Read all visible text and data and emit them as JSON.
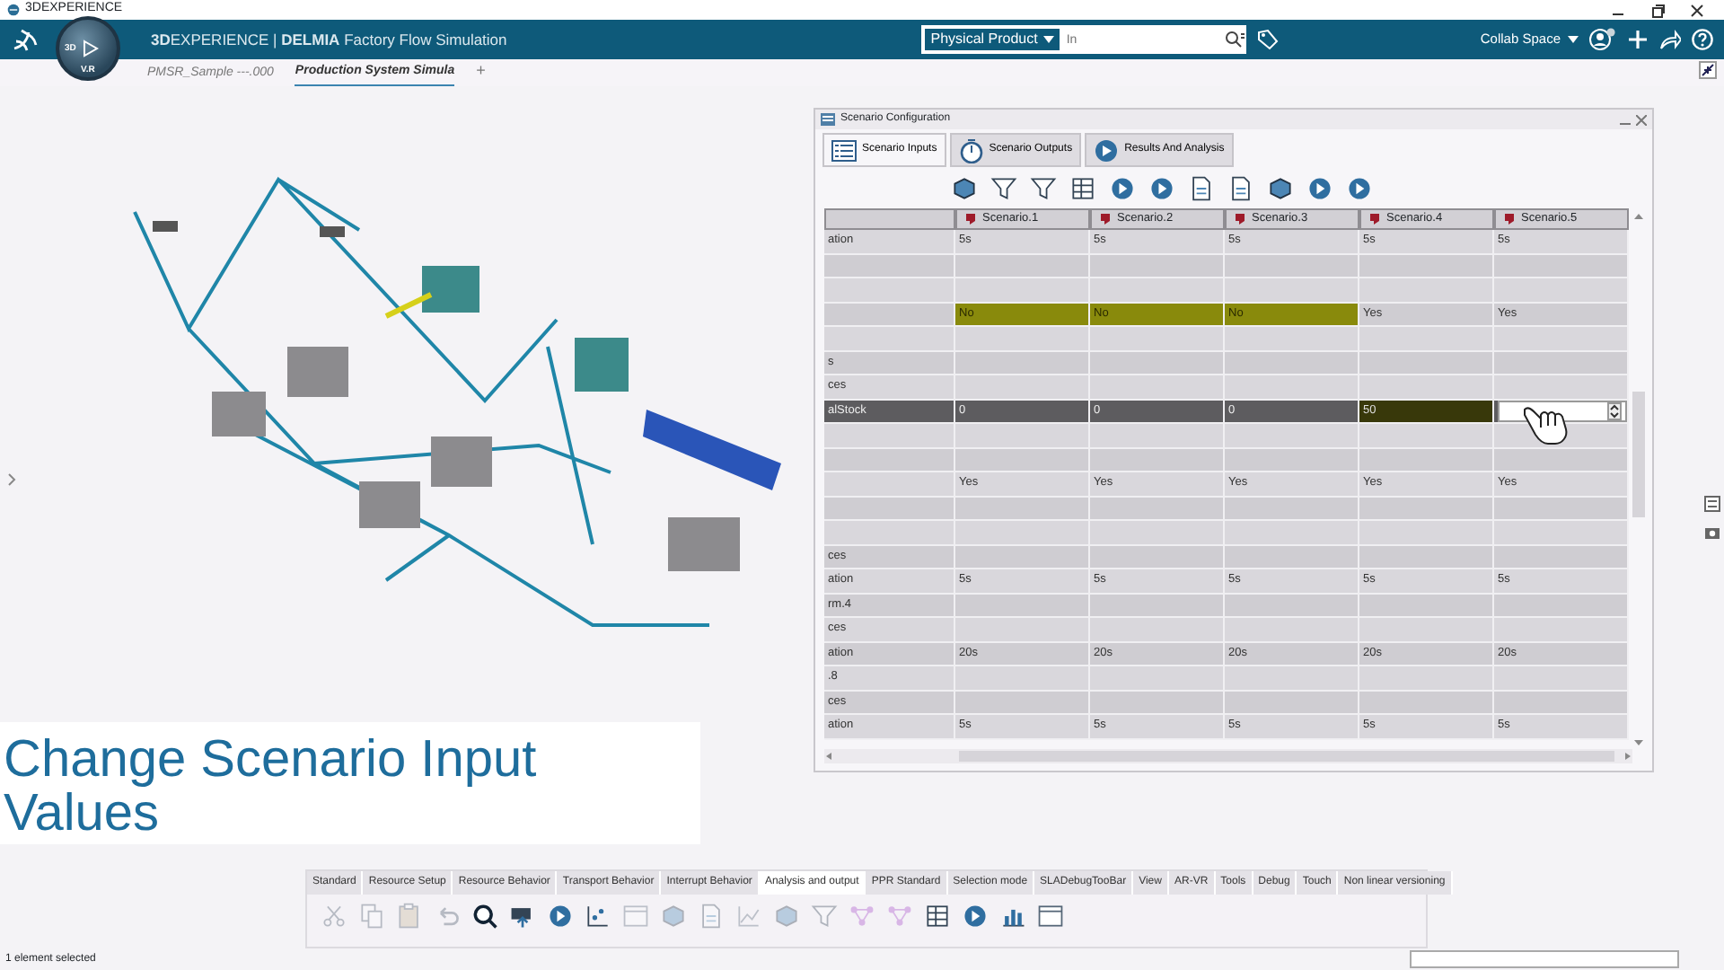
{
  "window": {
    "title": "3DEXPERIENCE"
  },
  "app_bar": {
    "title": "**3D**EXPERIENCE | **DELMIA** Factory Flow Simulation",
    "compass_labels": [
      "3D",
      "V.R"
    ],
    "search": {
      "scope": "Physical Product",
      "placeholder": "In"
    },
    "collab_space": "Collab Space"
  },
  "doc_tabs": [
    {
      "label": "PMSR_Sample ---.000",
      "selected": false
    },
    {
      "label": "Production System Simula",
      "selected": true
    }
  ],
  "add_tab": "+",
  "scenario_panel": {
    "title": "Scenario Configuration",
    "tabs": [
      {
        "label": "Scenario Inputs",
        "selected": true
      },
      {
        "label": "Scenario Outputs",
        "selected": false
      },
      {
        "label": "Results And Analysis",
        "selected": false
      }
    ],
    "columns": [
      "Scenario.1",
      "Scenario.2",
      "Scenario.3",
      "Scenario.4",
      "Scenario.5"
    ],
    "rows": [
      {
        "label": "ation",
        "selected": false,
        "cells": [
          {
            "kind": "text",
            "text": "5s",
            "highlighted": false
          },
          {
            "kind": "text",
            "text": "5s",
            "highlighted": false
          },
          {
            "kind": "text",
            "text": "5s",
            "highlighted": false
          },
          {
            "kind": "text",
            "text": "5s",
            "highlighted": false
          },
          {
            "kind": "text",
            "text": "5s",
            "highlighted": false
          }
        ]
      },
      {
        "selected": false
      },
      {
        "selected": false
      },
      {
        "selected": false,
        "cells": [
          {
            "kind": "text",
            "text": "No",
            "highlighted": true
          },
          {
            "kind": "text",
            "text": "No",
            "highlighted": true
          },
          {
            "kind": "text",
            "text": "No",
            "highlighted": true
          },
          {
            "kind": "text",
            "text": "Yes",
            "highlighted": false
          },
          {
            "kind": "text",
            "text": "Yes",
            "highlighted": false
          }
        ]
      },
      {
        "selected": false
      },
      {
        "label": "s",
        "selected": false
      },
      {
        "label": "ces",
        "selected": false
      },
      {
        "label": "alStock",
        "selected": true,
        "cells": [
          {
            "kind": "text",
            "text": "0",
            "highlighted": false
          },
          {
            "kind": "text",
            "text": "0",
            "highlighted": false
          },
          {
            "kind": "text",
            "text": "0",
            "highlighted": false
          },
          {
            "kind": "text",
            "text": "50",
            "highlighted": true
          },
          {
            "kind": "editor",
            "highlighted": false
          }
        ]
      },
      {
        "selected": false
      },
      {
        "selected": false
      },
      {
        "selected": false,
        "cells": [
          {
            "kind": "text",
            "text": "Yes",
            "highlighted": false
          },
          {
            "kind": "text",
            "text": "Yes",
            "highlighted": false
          },
          {
            "kind": "text",
            "text": "Yes",
            "highlighted": false
          },
          {
            "kind": "text",
            "text": "Yes",
            "highlighted": false
          },
          {
            "kind": "text",
            "text": "Yes",
            "highlighted": false
          }
        ]
      },
      {
        "selected": false
      },
      {
        "selected": false
      },
      {
        "label": "ces",
        "selected": false
      },
      {
        "label": "ation",
        "selected": false,
        "cells": [
          {
            "kind": "text",
            "text": "5s",
            "highlighted": false
          },
          {
            "kind": "text",
            "text": "5s",
            "highlighted": false
          },
          {
            "kind": "text",
            "text": "5s",
            "highlighted": false
          },
          {
            "kind": "text",
            "text": "5s",
            "highlighted": false
          },
          {
            "kind": "text",
            "text": "5s",
            "highlighted": false
          }
        ]
      },
      {
        "label": "rm.4",
        "selected": false
      },
      {
        "label": "ces",
        "selected": false
      },
      {
        "label": "ation",
        "selected": false,
        "cells": [
          {
            "kind": "text",
            "text": "20s",
            "highlighted": false
          },
          {
            "kind": "text",
            "text": "20s",
            "highlighted": false
          },
          {
            "kind": "text",
            "text": "20s",
            "highlighted": false
          },
          {
            "kind": "text",
            "text": "20s",
            "highlighted": false
          },
          {
            "kind": "text",
            "text": "20s",
            "highlighted": false
          }
        ]
      },
      {
        "label": ".8",
        "selected": false
      },
      {
        "label": "ces",
        "selected": false
      },
      {
        "label": "ation",
        "selected": false,
        "cells": [
          {
            "kind": "text",
            "text": "5s",
            "highlighted": false
          },
          {
            "kind": "text",
            "text": "5s",
            "highlighted": false
          },
          {
            "kind": "text",
            "text": "5s",
            "highlighted": false
          },
          {
            "kind": "text",
            "text": "5s",
            "highlighted": false
          },
          {
            "kind": "text",
            "text": "5s",
            "highlighted": false
          }
        ]
      }
    ]
  },
  "caption": "Change Scenario Input Values",
  "action_bar": {
    "tabs": [
      {
        "label": "Standard",
        "selected": false
      },
      {
        "label": "Resource Setup",
        "selected": false
      },
      {
        "label": "Resource Behavior",
        "selected": false
      },
      {
        "label": "Transport Behavior",
        "selected": false
      },
      {
        "label": "Interrupt Behavior",
        "selected": false
      },
      {
        "label": "Analysis and output",
        "selected": true
      },
      {
        "label": "PPR Standard",
        "selected": false
      },
      {
        "label": "Selection mode",
        "selected": false
      },
      {
        "label": "SLADebugTooBar",
        "selected": false
      },
      {
        "label": "View",
        "selected": false
      },
      {
        "label": "AR-VR",
        "selected": false
      },
      {
        "label": "Tools",
        "selected": false
      },
      {
        "label": "Debug",
        "selected": false
      },
      {
        "label": "Touch",
        "selected": false
      },
      {
        "label": "Non linear versioning",
        "selected": false
      }
    ],
    "tools": [
      {
        "disabled": true
      },
      {
        "disabled": true
      },
      {
        "disabled": true
      },
      {
        "disabled": true
      },
      {
        "disabled": false
      },
      {
        "disabled": false
      },
      {
        "disabled": false
      },
      {
        "disabled": false
      },
      {
        "disabled": true
      },
      {
        "disabled": true
      },
      {
        "disabled": true
      },
      {
        "disabled": true
      },
      {
        "disabled": true
      },
      {
        "disabled": true
      },
      {
        "disabled": true
      },
      {
        "disabled": true
      },
      {
        "disabled": false
      },
      {
        "disabled": false
      },
      {
        "disabled": false
      },
      {
        "disabled": false
      }
    ]
  },
  "status_bar": {
    "text": "1 element selected"
  }
}
